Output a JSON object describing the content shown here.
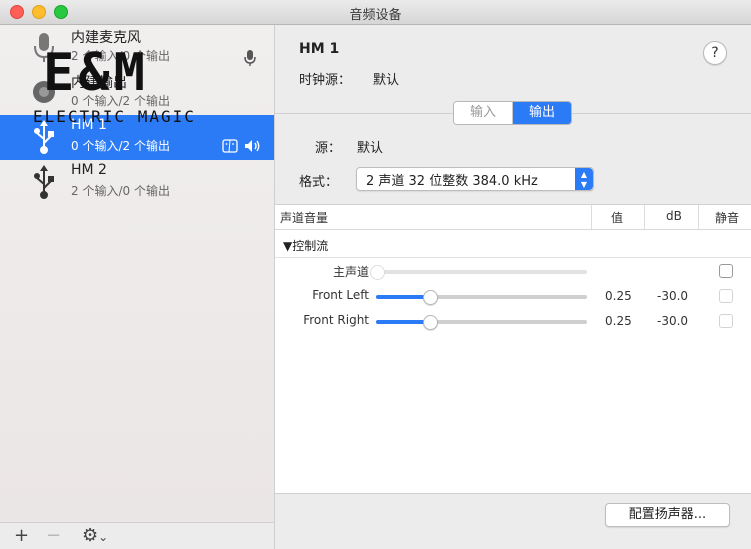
{
  "window": {
    "title": "音频设备"
  },
  "logo": {
    "main": "E&M",
    "tagline": "ELECTRIC MAGIC"
  },
  "devices": [
    {
      "name": "内建麦克风",
      "sub": "2 个输入/0 个输出",
      "icon": "microphone-icon",
      "selected": false
    },
    {
      "name": "内建输出",
      "sub": "0 个输入/2 个输出",
      "icon": "speaker-icon",
      "selected": false
    },
    {
      "name": "HM 1",
      "sub": "0 个输入/2 个输出",
      "icon": "usb-icon",
      "selected": true
    },
    {
      "name": "HM 2",
      "sub": "2 个输入/0 个输出",
      "icon": "usb-icon",
      "selected": false
    }
  ],
  "bottombar": {
    "add": "+",
    "remove": "−",
    "gear": "⚙",
    "gear_caret": "⌄"
  },
  "detail": {
    "title": "HM 1",
    "clock_label": "时钟源：",
    "clock_value": "默认",
    "help": "?",
    "tabs": [
      "输入",
      "输出"
    ],
    "active_tab": "输出",
    "source_label": "源：",
    "source_value": "默认",
    "format_label": "格式：",
    "format_value": "2 声道 32 位整数 384.0 kHz"
  },
  "table": {
    "headers": {
      "volume": "声道音量",
      "value": "值",
      "db": "dB",
      "mute": "静音"
    },
    "group": "▼控制流",
    "rows": [
      {
        "label": "主声道",
        "value": "",
        "db": "",
        "level": 0,
        "enabled": false
      },
      {
        "label": "Front Left",
        "value": "0.25",
        "db": "-30.0",
        "level": 0.25,
        "enabled": true
      },
      {
        "label": "Front Right",
        "value": "0.25",
        "db": "-30.0",
        "level": 0.25,
        "enabled": true
      }
    ]
  },
  "config_button": "配置扬声器..."
}
